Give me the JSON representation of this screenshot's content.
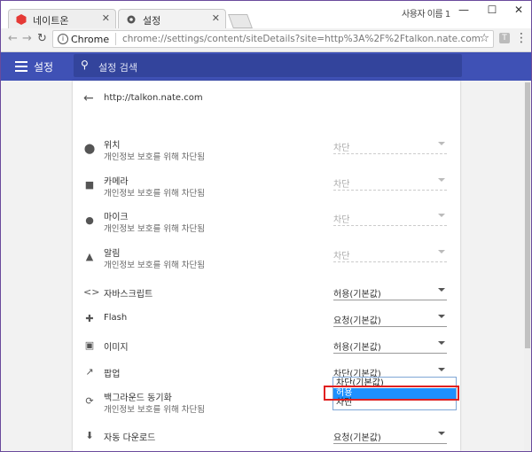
{
  "window": {
    "user_name": "사용자 이름 1",
    "tabs": [
      {
        "label": "네이트온",
        "active": false
      },
      {
        "label": "설정",
        "active": true
      }
    ],
    "controls": {
      "minimize": "—",
      "maximize": "☐",
      "close": "✕"
    }
  },
  "toolbar": {
    "scheme_label": "Chrome",
    "url": "chrome://settings/content/siteDetails?site=http%3A%2F%2Ftalkon.nate.com",
    "extension_label": "T"
  },
  "settings_header": {
    "title": "설정",
    "search_placeholder": "설정 검색",
    "color": "#3f51b5"
  },
  "site_details": {
    "site": "http://talkon.nate.com",
    "permissions": [
      {
        "icon": "location-icon",
        "glyph": "⬤",
        "label": "위치",
        "sub": "개인정보 보호를 위해 차단됨",
        "value": "차단",
        "disabled": true
      },
      {
        "icon": "camera-icon",
        "glyph": "■",
        "label": "카메라",
        "sub": "개인정보 보호를 위해 차단됨",
        "value": "차단",
        "disabled": true
      },
      {
        "icon": "microphone-icon",
        "glyph": "●",
        "label": "마이크",
        "sub": "개인정보 보호를 위해 차단됨",
        "value": "차단",
        "disabled": true
      },
      {
        "icon": "bell-icon",
        "glyph": "▲",
        "label": "알림",
        "sub": "개인정보 보호를 위해 차단됨",
        "value": "차단",
        "disabled": true
      },
      {
        "icon": "code-icon",
        "glyph": "<>",
        "label": "자바스크립트",
        "sub": "",
        "value": "허용(기본값)",
        "disabled": false
      },
      {
        "icon": "puzzle-icon",
        "glyph": "✚",
        "label": "Flash",
        "sub": "",
        "value": "요청(기본값)",
        "disabled": false
      },
      {
        "icon": "image-icon",
        "glyph": "▣",
        "label": "이미지",
        "sub": "",
        "value": "허용(기본값)",
        "disabled": false
      },
      {
        "icon": "popup-icon",
        "glyph": "↗",
        "label": "팝업",
        "sub": "",
        "value": "차단(기본값)",
        "disabled": false
      },
      {
        "icon": "sync-icon",
        "glyph": "⟳",
        "label": "백그라운드 동기화",
        "sub": "개인정보 보호를 위해 차단됨",
        "value": "",
        "disabled": false
      },
      {
        "icon": "download-icon",
        "glyph": "⬇",
        "label": "자동 다운로드",
        "sub": "",
        "value": "요청(기본값)",
        "disabled": false
      }
    ],
    "popup_dropdown": {
      "options": [
        "차단(기본값)",
        "허용",
        "차단"
      ],
      "highlighted": "허용",
      "highlight_color": "#1e90ff"
    }
  }
}
